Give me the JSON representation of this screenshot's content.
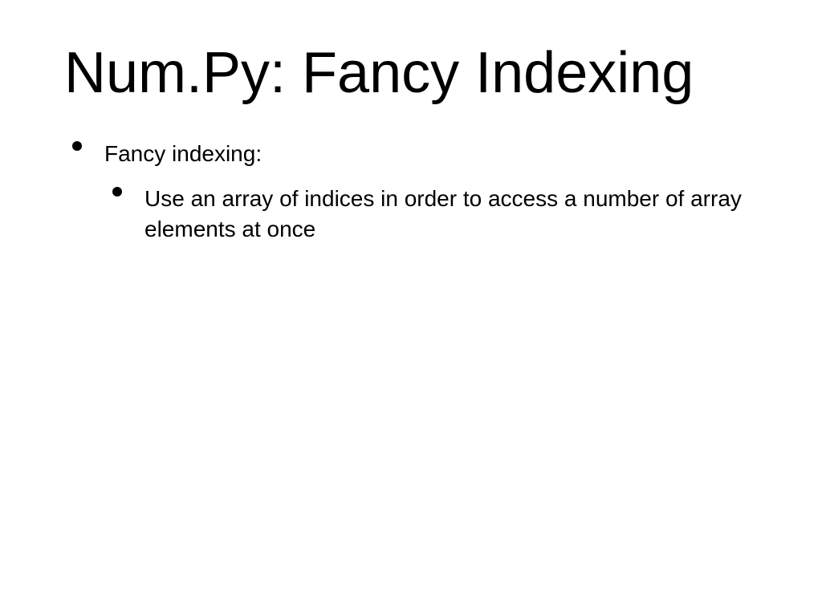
{
  "slide": {
    "title": "Num.Py: Fancy Indexing",
    "bullets": {
      "item1": "Fancy indexing:",
      "subitem1": "Use an array of indices in order to access a number of array elements at once"
    }
  }
}
